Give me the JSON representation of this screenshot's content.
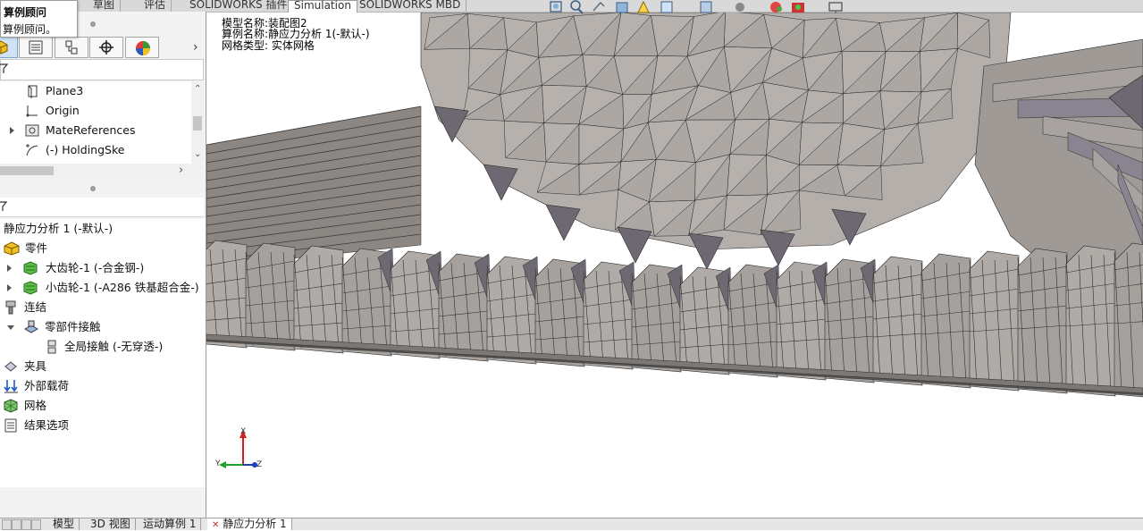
{
  "tooltip": {
    "title": "算例顾问",
    "text": "算例顾问。"
  },
  "ribbon": {
    "tabs": [
      "草图",
      "评估",
      "SOLIDWORKS 插件",
      "Simulation",
      "SOLIDWORKS MBD"
    ],
    "active": "Simulation"
  },
  "feature_tree": {
    "items": [
      {
        "label": "Plane3",
        "icon": "plane-icon"
      },
      {
        "label": "Origin",
        "icon": "origin-icon"
      },
      {
        "label": "MateReferences",
        "icon": "mate-references-icon"
      },
      {
        "label": "(-) HoldingSke",
        "icon": "sketch-icon"
      }
    ]
  },
  "study_tree": {
    "study": "静应力分析 1 (-默认-)",
    "parts_label": "零件",
    "part1": "大齿轮-1 (-合金钢-)",
    "part2": "小齿轮-1 (-A286 铁基超合金-)",
    "connections": "连结",
    "component_contacts": "零部件接触",
    "global_contact": "全局接触 (-无穿透-)",
    "fixtures": "夹具",
    "external_loads": "外部载荷",
    "mesh": "网格",
    "result_options": "结果选项"
  },
  "viewport": {
    "model_name": "模型名称:装配图2",
    "study_name": "算例名称:静应力分析 1(-默认-)",
    "mesh_type": "网格类型: 实体网格",
    "triad": {
      "x": "X",
      "y": "Y",
      "z": "Z"
    }
  },
  "bottom_tabs": [
    "模型",
    "3D 视图",
    "运动算例 1",
    "静应力分析 1"
  ],
  "colors": {
    "mesh_fill": "#a9a49f",
    "mesh_dark": "#6e6872",
    "mesh_line": "#2a2a2a",
    "panel_bg": "#f3f3f3"
  }
}
